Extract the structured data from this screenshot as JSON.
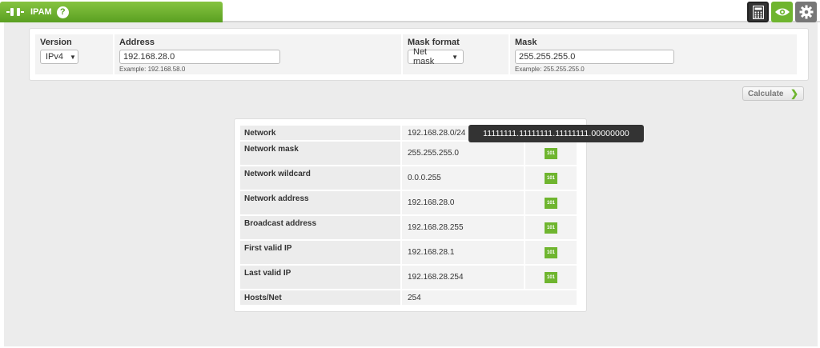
{
  "header": {
    "title": "IPAM",
    "help_label": "?",
    "icons": [
      "plug-icon",
      "calculator-icon",
      "eye-icon",
      "gear-icon"
    ]
  },
  "form": {
    "version": {
      "label": "Version",
      "value": "IPv4"
    },
    "address": {
      "label": "Address",
      "value": "192.168.28.0",
      "hint": "Example: 192.168.58.0"
    },
    "mask_format": {
      "label": "Mask format",
      "value": "Net mask"
    },
    "mask": {
      "label": "Mask",
      "value": "255.255.255.0",
      "hint": "Example: 255.255.255.0"
    }
  },
  "calculate_label": "Calculate",
  "results": [
    {
      "label": "Network",
      "value": "192.168.28.0/24"
    },
    {
      "label": "Network mask",
      "value": "255.255.255.0",
      "bin": "101"
    },
    {
      "label": "Network wildcard",
      "value": "0.0.0.255",
      "bin": "101"
    },
    {
      "label": "Network address",
      "value": "192.168.28.0",
      "bin": "101"
    },
    {
      "label": "Broadcast address",
      "value": "192.168.28.255",
      "bin": "101"
    },
    {
      "label": "First valid IP",
      "value": "192.168.28.1",
      "bin": "101"
    },
    {
      "label": "Last valid IP",
      "value": "192.168.28.254",
      "bin": "101"
    },
    {
      "label": "Hosts/Net",
      "value": "254"
    }
  ],
  "tooltip": "11111111.11111111.11111111.00000000",
  "colors": {
    "accent": "#6fb52f",
    "tooltip_bg": "#333333"
  }
}
